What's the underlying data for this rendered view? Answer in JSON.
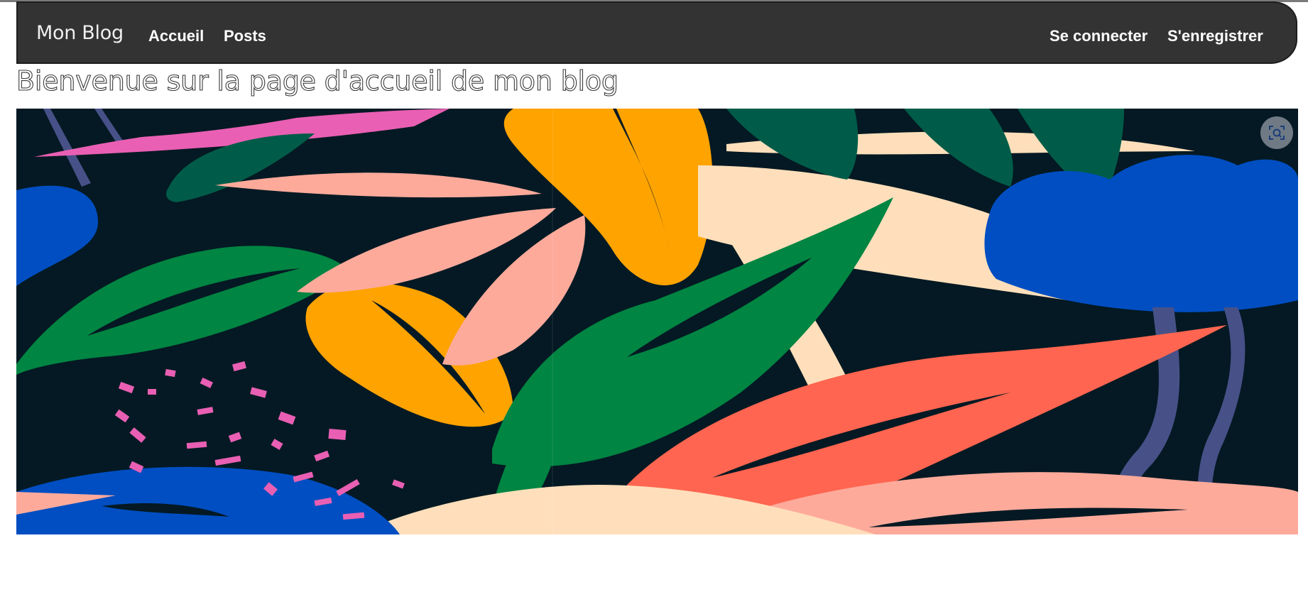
{
  "navbar": {
    "brand": "Mon Blog",
    "links": {
      "home": "Accueil",
      "posts": "Posts",
      "login": "Se connecter",
      "register": "S'enregistrer"
    }
  },
  "main": {
    "heading": "Bienvenue sur la page d'accueil de mon blog"
  },
  "banner": {
    "image_icon": "visual-search-icon"
  },
  "colors": {
    "navbar_bg": "#333333",
    "banner_bg": "#041923",
    "pink": "#e95fb3",
    "orange": "#ffa300",
    "green": "#008542",
    "dark_green": "#005c48",
    "salmon": "#fdaa9b",
    "coral": "#ff6550",
    "cream": "#ffdfbb",
    "blue": "#004ec2",
    "slate": "#475188"
  }
}
